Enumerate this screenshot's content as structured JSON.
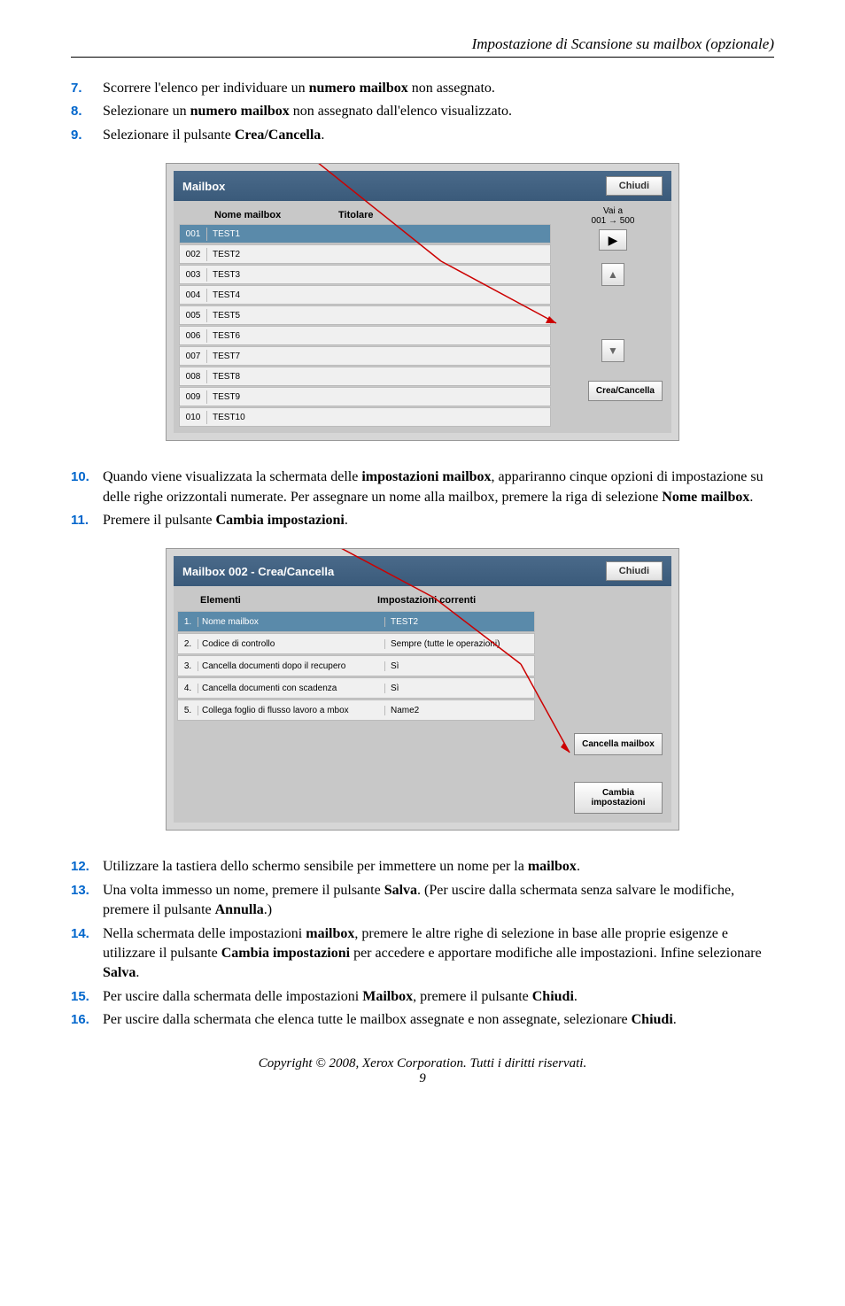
{
  "header": "Impostazione di Scansione su mailbox (opzionale)",
  "steps_a": [
    {
      "n": "7.",
      "txt_pre": "Scorrere l'elenco per individuare un ",
      "b1": "numero mailbox",
      "txt_post": " non assegnato."
    },
    {
      "n": "8.",
      "txt_pre": "Selezionare un ",
      "b1": "numero mailbox",
      "txt_post": " non assegnato dall'elenco visualizzato."
    },
    {
      "n": "9.",
      "txt_pre": "Selezionare il pulsante ",
      "b1": "Crea/Cancella",
      "txt_post": "."
    }
  ],
  "panel1": {
    "title": "Mailbox",
    "close": "Chiudi",
    "col1": "Nome mailbox",
    "col2": "Titolare",
    "goto_label": "Vai a",
    "goto_range": "001 → 500",
    "crea_btn": "Crea/Cancella",
    "rows": [
      {
        "idx": "001",
        "name": "TEST1",
        "selected": true
      },
      {
        "idx": "002",
        "name": "TEST2"
      },
      {
        "idx": "003",
        "name": "TEST3"
      },
      {
        "idx": "004",
        "name": "TEST4"
      },
      {
        "idx": "005",
        "name": "TEST5"
      },
      {
        "idx": "006",
        "name": "TEST6"
      },
      {
        "idx": "007",
        "name": "TEST7"
      },
      {
        "idx": "008",
        "name": "TEST8"
      },
      {
        "idx": "009",
        "name": "TEST9"
      },
      {
        "idx": "010",
        "name": "TEST10"
      }
    ]
  },
  "steps_b": [
    {
      "n": "10.",
      "txt_pre": "Quando viene visualizzata la schermata delle ",
      "b1": "impostazioni mailbox",
      "txt_mid": ", appariranno cinque opzioni di impostazione su delle righe orizzontali numerate. Per assegnare un nome alla mailbox, premere la riga di selezione ",
      "b2": "Nome mailbox",
      "txt_post": "."
    },
    {
      "n": "11.",
      "txt_pre": "Premere il pulsante ",
      "b1": "Cambia impostazioni",
      "txt_post": "."
    }
  ],
  "panel2": {
    "title": "Mailbox 002 - Crea/Cancella",
    "close": "Chiudi",
    "col1": "Elementi",
    "col2": "Impostazioni correnti",
    "cancella_btn": "Cancella mailbox",
    "cambia_btn": "Cambia impostazioni",
    "rows": [
      {
        "idx": "1.",
        "name": "Nome mailbox",
        "val": "TEST2",
        "selected": true
      },
      {
        "idx": "2.",
        "name": "Codice di controllo",
        "val": "Sempre (tutte le operazioni)"
      },
      {
        "idx": "3.",
        "name": "Cancella documenti dopo il recupero",
        "val": "Sì"
      },
      {
        "idx": "4.",
        "name": "Cancella documenti con scadenza",
        "val": "Sì"
      },
      {
        "idx": "5.",
        "name": "Collega foglio di flusso lavoro a mbox",
        "val": "Name2"
      }
    ]
  },
  "steps_c": [
    {
      "n": "12.",
      "txt_pre": "Utilizzare la tastiera dello schermo sensibile per immettere un nome per la ",
      "b1": "mailbox",
      "txt_post": "."
    },
    {
      "n": "13.",
      "txt_pre": "Una volta immesso un nome, premere il pulsante ",
      "b1": "Salva",
      "txt_mid": ". (Per uscire dalla schermata senza salvare le modifiche, premere il pulsante ",
      "b2": "Annulla",
      "txt_post": ".)"
    },
    {
      "n": "14.",
      "txt_pre": "Nella schermata delle impostazioni ",
      "b1": "mailbox",
      "txt_mid": ", premere le altre righe di selezione in base alle proprie esigenze e utilizzare il pulsante ",
      "b2": "Cambia impostazioni",
      "txt_mid2": " per accedere e apportare modifiche alle impostazioni. Infine selezionare ",
      "b3": "Salva",
      "txt_post": "."
    },
    {
      "n": "15.",
      "txt_pre": "Per uscire dalla schermata delle impostazioni ",
      "b1": "Mailbox",
      "txt_mid": ", premere il pulsante ",
      "b2": "Chiudi",
      "txt_post": "."
    },
    {
      "n": "16.",
      "txt_pre": "Per uscire dalla schermata che elenca tutte le mailbox assegnate e non assegnate, selezionare ",
      "b1": "Chiudi",
      "txt_post": "."
    }
  ],
  "copyright": "Copyright © 2008, Xerox Corporation. Tutti i diritti riservati.",
  "pagenum": "9"
}
